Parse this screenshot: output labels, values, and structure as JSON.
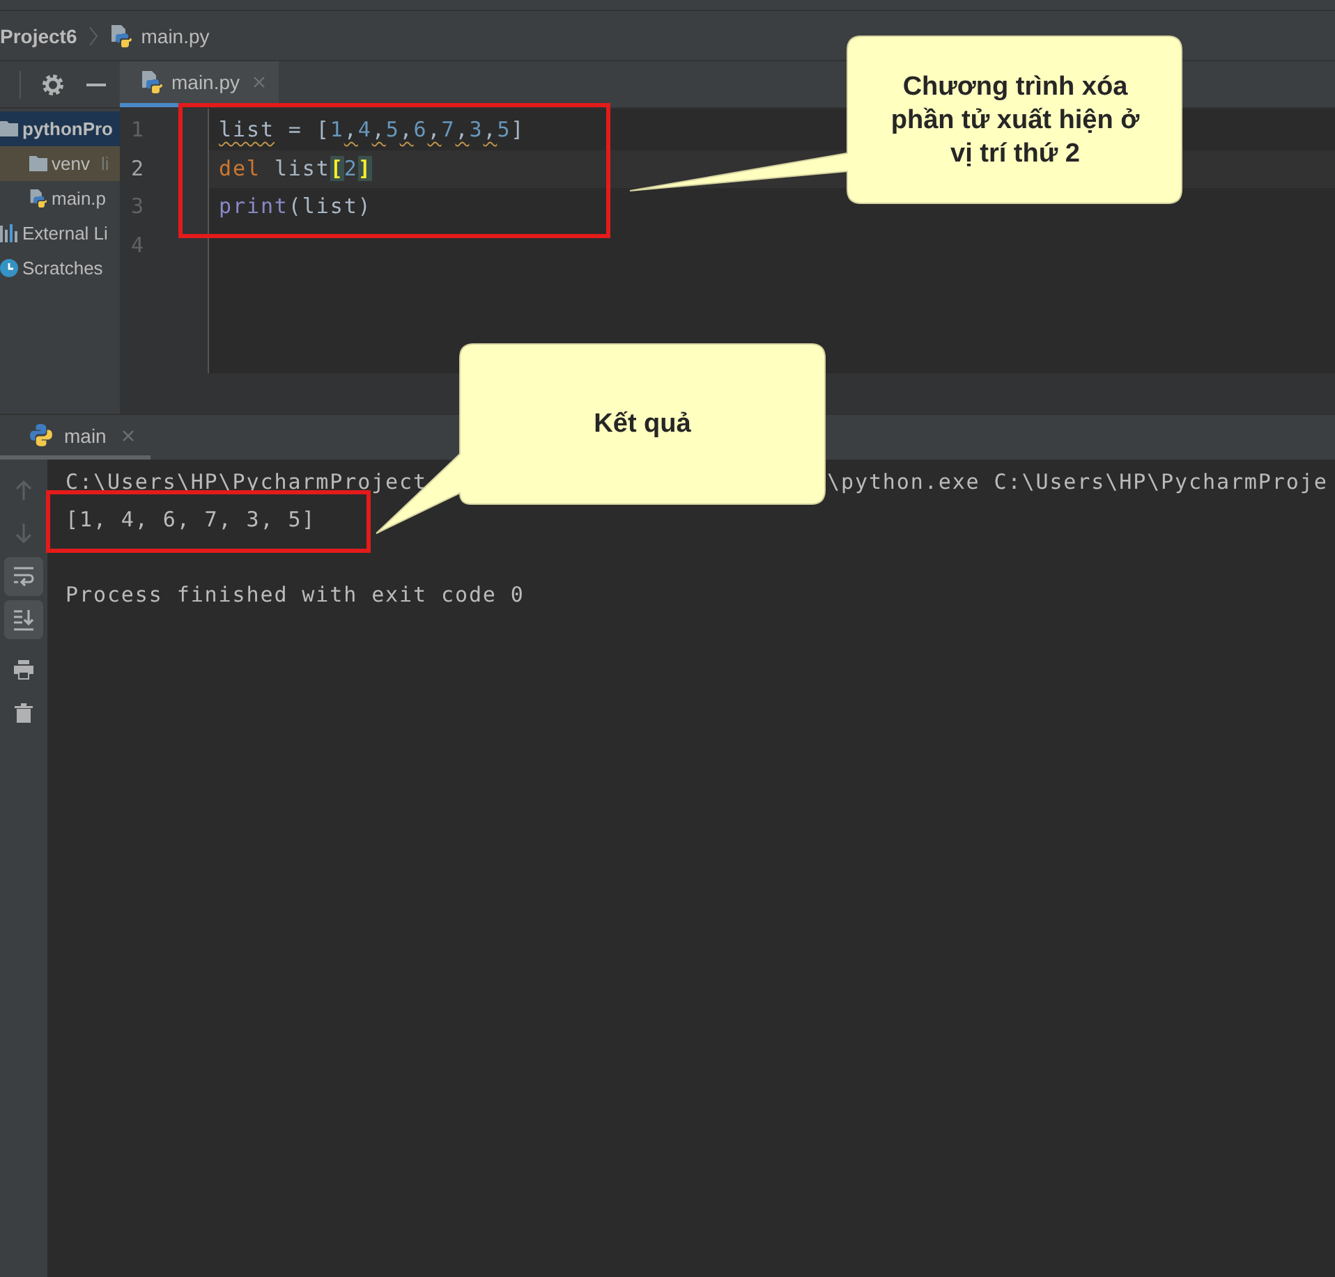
{
  "breadcrumb": [
    {
      "text": "Project6",
      "kind": "project"
    },
    {
      "text": "main.py",
      "kind": "file"
    }
  ],
  "project_tree": {
    "items": [
      {
        "label": "pythonPro",
        "kind": "project_root",
        "selected": true,
        "excluded": false,
        "children": [
          {
            "label": "venv",
            "hint": "li",
            "kind": "folder",
            "selected": false,
            "excluded": true
          },
          {
            "label": "main.p",
            "kind": "python_file",
            "selected": false,
            "excluded": false
          }
        ]
      },
      {
        "label": "External Li",
        "kind": "library",
        "selected": false,
        "excluded": false
      },
      {
        "label": "Scratches",
        "kind": "scratches",
        "selected": false,
        "excluded": false
      }
    ]
  },
  "editor": {
    "tabs": [
      {
        "label": "main.py",
        "selected": true
      }
    ],
    "lines": [
      {
        "number": "1",
        "current": false,
        "tokens": [
          {
            "text": "list",
            "kind": "flagged_name"
          },
          {
            "text": " = ",
            "kind": "operator"
          },
          {
            "text": "[",
            "kind": "bracket"
          },
          {
            "text": "1",
            "kind": "number"
          },
          {
            "text": ",",
            "kind": "flagged_operator"
          },
          {
            "text": "4",
            "kind": "number"
          },
          {
            "text": ",",
            "kind": "flagged_operator"
          },
          {
            "text": "5",
            "kind": "number"
          },
          {
            "text": ",",
            "kind": "flagged_operator"
          },
          {
            "text": "6",
            "kind": "number"
          },
          {
            "text": ",",
            "kind": "flagged_operator"
          },
          {
            "text": "7",
            "kind": "number"
          },
          {
            "text": ",",
            "kind": "flagged_operator"
          },
          {
            "text": "3",
            "kind": "number"
          },
          {
            "text": ",",
            "kind": "flagged_operator"
          },
          {
            "text": "5",
            "kind": "number"
          },
          {
            "text": "]",
            "kind": "bracket"
          }
        ]
      },
      {
        "number": "2",
        "current": true,
        "tokens": [
          {
            "text": "del ",
            "kind": "keyword"
          },
          {
            "text": "list",
            "kind": "name"
          },
          {
            "text": "[",
            "kind": "matched_bracket"
          },
          {
            "text": "2",
            "kind": "number"
          },
          {
            "kind": "caret"
          },
          {
            "text": "]",
            "kind": "matched_bracket"
          }
        ]
      },
      {
        "number": "3",
        "current": false,
        "tokens": [
          {
            "text": "print",
            "kind": "builtin"
          },
          {
            "text": "(list)",
            "kind": "operator"
          }
        ]
      },
      {
        "number": "4",
        "current": false
      }
    ]
  },
  "run_panel": {
    "tabs": [
      {
        "label": "main",
        "selected": true
      }
    ],
    "toolbar": [
      {
        "kind": "up",
        "disabled": true,
        "toggled": false
      },
      {
        "kind": "down",
        "disabled": true,
        "toggled": false
      },
      {
        "kind": "soft_wrap",
        "disabled": false,
        "toggled": true
      },
      {
        "kind": "scroll_end",
        "disabled": false,
        "toggled": true
      },
      {
        "kind": "print",
        "disabled": false,
        "toggled": false
      },
      {
        "kind": "trash",
        "disabled": false,
        "toggled": false
      }
    ],
    "console": [
      {
        "kind": "command",
        "segments": [
          "C:\\Users\\HP\\PycharmProject",
          "\\python.exe C:\\Users\\HP\\PycharmProje"
        ]
      },
      {
        "kind": "output",
        "segments": [
          "[1, 4, 6, 7, 3, 5]"
        ]
      },
      {
        "kind": "exit",
        "segments": [
          "Process finished with exit code 0"
        ]
      }
    ]
  },
  "callouts": [
    {
      "text": "Chương trình xóa phần tử xuất hiện ở vị trí thứ 2"
    },
    {
      "text": "Kết quả"
    }
  ]
}
